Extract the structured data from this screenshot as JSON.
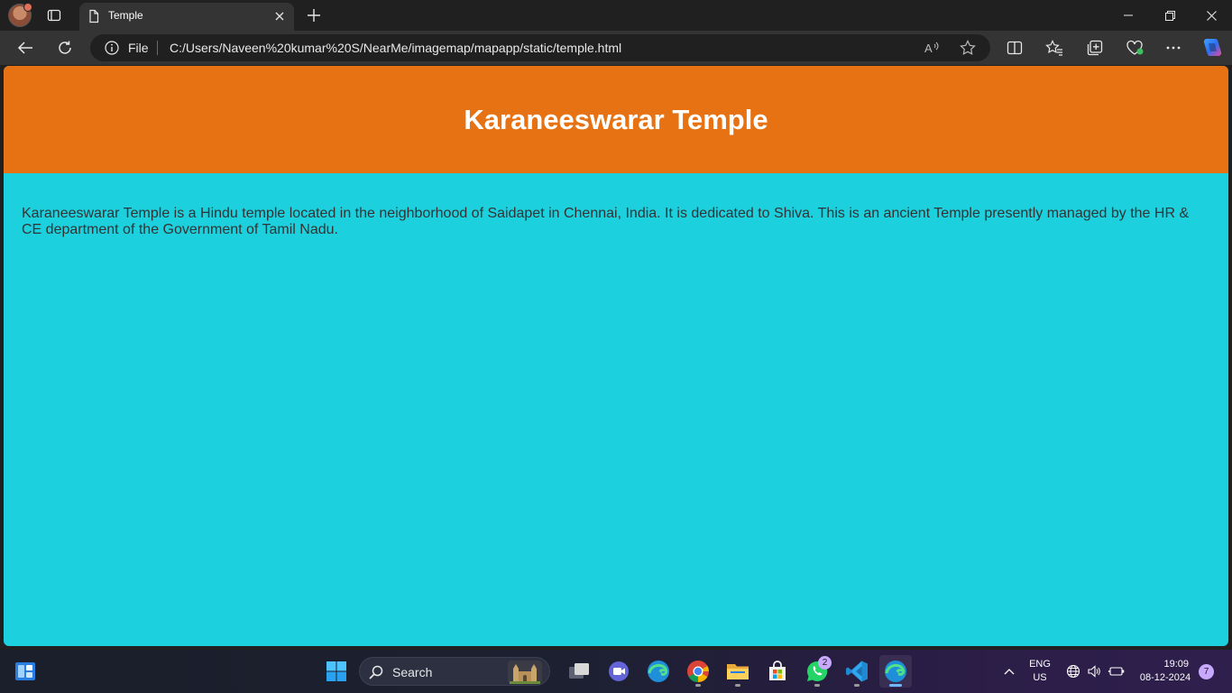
{
  "browser": {
    "tab": {
      "title": "Temple"
    },
    "address": {
      "scheme_label": "File",
      "url": "C:/Users/Naveen%20kumar%20S/NearMe/imagemap/mapapp/static/temple.html"
    },
    "read_aloud_label": "A"
  },
  "page": {
    "header": {
      "title": "Karaneeswarar Temple",
      "background": "#e77213"
    },
    "body": {
      "background": "#1cd0de",
      "paragraph": "Karaneeswarar Temple is a Hindu temple located in the neighborhood of Saidapet in Chennai, India. It is dedicated to Shiva. This is an ancient Temple presently managed by the HR & CE department of the Government of Tamil Nadu."
    }
  },
  "taskbar": {
    "search_label": "Search",
    "whatsapp_badge": "2",
    "language": {
      "lang": "ENG",
      "region": "US"
    },
    "clock": {
      "time": "19:09",
      "date": "08-12-2024"
    },
    "notification_count": "7",
    "apps": [
      "widgets",
      "start",
      "search",
      "task-view",
      "teams",
      "edge",
      "chrome",
      "file-explorer",
      "store",
      "whatsapp",
      "vscode",
      "edge-active"
    ]
  }
}
